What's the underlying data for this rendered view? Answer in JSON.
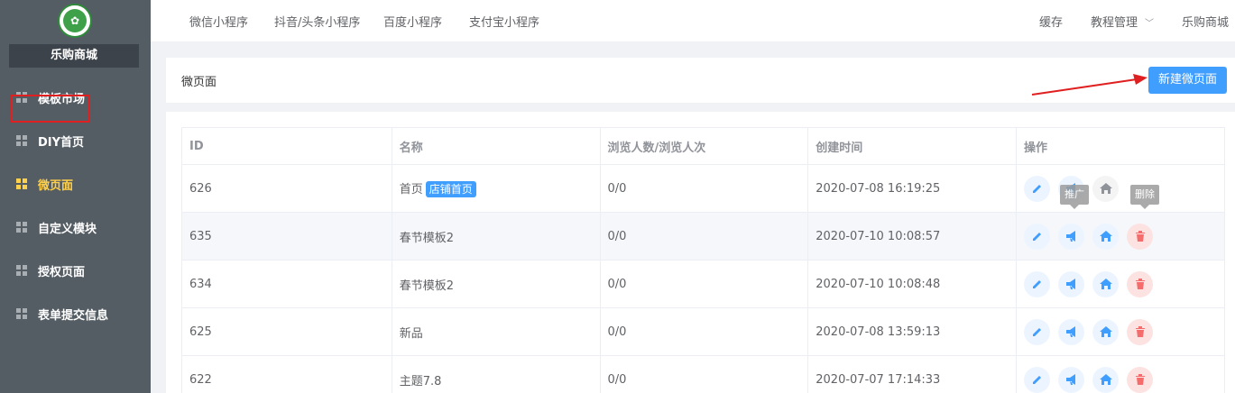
{
  "sidebar": {
    "store_name": "乐购商城",
    "items": [
      {
        "label": "模板市场"
      },
      {
        "label": "DIY首页"
      },
      {
        "label": "微页面"
      },
      {
        "label": "自定义模块"
      },
      {
        "label": "授权页面"
      },
      {
        "label": "表单提交信息"
      }
    ]
  },
  "topnav": {
    "tabs": [
      "微信小程序",
      "抖音/头条小程序",
      "百度小程序",
      "支付宝小程序"
    ],
    "cache": "缓存",
    "tutorial": "教程管理",
    "store": "乐购商城"
  },
  "header": {
    "title": "微页面",
    "new_button": "新建微页面"
  },
  "table": {
    "columns": [
      "ID",
      "名称",
      "浏览人数/浏览人次",
      "创建时间",
      "操作"
    ],
    "rows": [
      {
        "id": "626",
        "name": "首页",
        "tag": "店铺首页",
        "views": "0/0",
        "created": "2020-07-08 16:19:25"
      },
      {
        "id": "635",
        "name": "春节模板2",
        "tag": "",
        "views": "0/0",
        "created": "2020-07-10 10:08:57"
      },
      {
        "id": "634",
        "name": "春节模板2",
        "tag": "",
        "views": "0/0",
        "created": "2020-07-10 10:08:48"
      },
      {
        "id": "625",
        "name": "新品",
        "tag": "",
        "views": "0/0",
        "created": "2020-07-08 13:59:13"
      },
      {
        "id": "622",
        "name": "主题7.8",
        "tag": "",
        "views": "0/0",
        "created": "2020-07-07 17:14:33"
      }
    ]
  },
  "tooltips": {
    "promote": "推广",
    "delete": "删除"
  },
  "colors": {
    "sidebar_bg": "#545c64",
    "active": "#ffd04b",
    "primary": "#409eff",
    "danger": "#f56c6c",
    "arrow": "#e02020"
  }
}
